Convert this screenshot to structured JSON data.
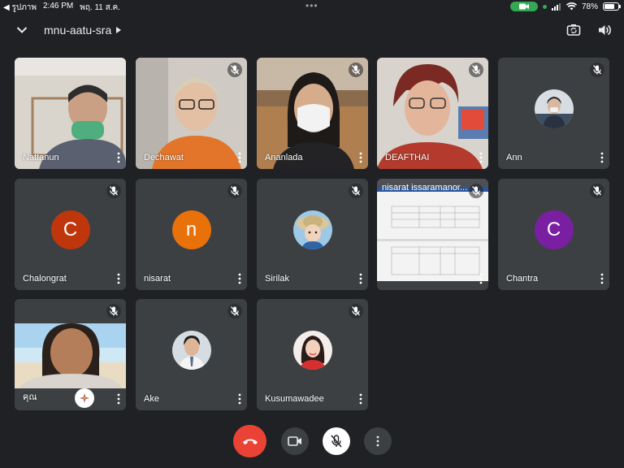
{
  "status_bar": {
    "back_app": "◀ รูปภาพ",
    "time": "2:46 PM",
    "date": "พฤ. 11 ส.ค.",
    "battery_percent": "78%",
    "battery_level": 0.78
  },
  "header": {
    "meeting_code": "mnu-aatu-sra",
    "collapse_icon": "chevron-down-icon",
    "camera_switch_icon": "camera-flip-icon",
    "audio_icon": "speaker-icon"
  },
  "participants": [
    {
      "name": "Nattanun",
      "muted": false,
      "kind": "video"
    },
    {
      "name": "Dechawat",
      "muted": true,
      "kind": "video"
    },
    {
      "name": "Ananlada",
      "muted": true,
      "kind": "video"
    },
    {
      "name": "DEAFTHAI",
      "muted": true,
      "kind": "video"
    },
    {
      "name": "Ann",
      "muted": true,
      "kind": "photo"
    },
    {
      "name": "Chalongrat",
      "muted": true,
      "kind": "letter",
      "letter": "C",
      "color": "#bf360c"
    },
    {
      "name": "nisarat",
      "muted": true,
      "kind": "letter",
      "letter": "n",
      "color": "#e8710a"
    },
    {
      "name": "Sirilak",
      "muted": true,
      "kind": "photo"
    },
    {
      "name": "Chantra",
      "muted": true,
      "kind": "letter",
      "letter": "C",
      "color": "#7b1fa2"
    },
    {
      "name": "คุณ",
      "muted": true,
      "kind": "video"
    },
    {
      "name": "Ake",
      "muted": true,
      "kind": "photo"
    },
    {
      "name": "Kusumawadee",
      "muted": true,
      "kind": "photo"
    }
  ],
  "screenshare": {
    "title": "nisarat issaramanor...",
    "muted": true
  },
  "controls": {
    "end_call_icon": "phone-hangup-icon",
    "camera_icon": "video-camera-icon",
    "mic_icon": "mic-off-icon",
    "more_icon": "more-vertical-icon"
  },
  "colors": {
    "background": "#202124",
    "tile": "#3c4043",
    "end_call": "#ea4335",
    "camera_indicator": "#34a853"
  }
}
